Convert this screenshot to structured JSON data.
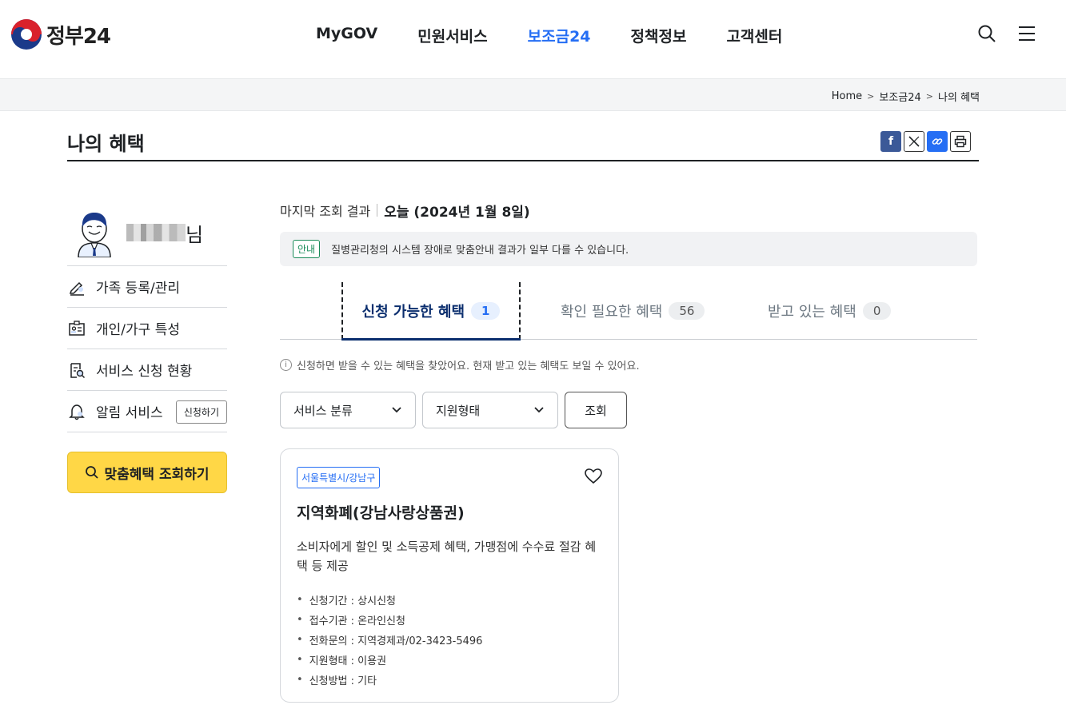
{
  "header": {
    "logo_text": "정부24",
    "nav": [
      {
        "label": "MyGOV",
        "active": false
      },
      {
        "label": "민원서비스",
        "active": false
      },
      {
        "label": "보조금24",
        "active": true
      },
      {
        "label": "정책정보",
        "active": false
      },
      {
        "label": "고객센터",
        "active": false
      }
    ]
  },
  "breadcrumb": [
    "Home",
    "보조금24",
    "나의 혜택"
  ],
  "page": {
    "title": "나의 혜택"
  },
  "sidebar": {
    "user_suffix": "님",
    "items": [
      {
        "label": "가족 등록/관리",
        "icon": "pencil-icon"
      },
      {
        "label": "개인/가구 특성",
        "icon": "id-card-icon"
      },
      {
        "label": "서비스 신청 현황",
        "icon": "clipboard-search-icon"
      },
      {
        "label": "알림 서비스",
        "icon": "bell-icon",
        "button": "신청하기"
      }
    ],
    "search_button": "맞춤혜택 조회하기"
  },
  "main": {
    "last_view_label": "마지막 조회 결과",
    "last_view_date": "오늘 (2024년 1월 8일)",
    "notice_tag": "안내",
    "notice_text": "질병관리청의 시스템 장애로 맞춤안내 결과가 일부 다를 수 있습니다.",
    "tabs": [
      {
        "label": "신청 가능한 혜택",
        "count": "1",
        "active": true
      },
      {
        "label": "확인 필요한 혜택",
        "count": "56",
        "active": false
      },
      {
        "label": "받고 있는 혜택",
        "count": "0",
        "active": false
      }
    ],
    "hint": "신청하면 받을 수 있는 혜택을 찾았어요. 현재 받고 있는 혜택도 보일 수 있어요.",
    "filters": {
      "category": "서비스 분류",
      "support_type": "지원형태",
      "query_button": "조회"
    },
    "card": {
      "region": "서울특별시/강남구",
      "title": "지역화폐(강남사랑상품권)",
      "description": "소비자에게 할인 및 소득공제 혜택, 가맹점에 수수료 절감 혜택 등 제공",
      "details": [
        "신청기간 : 상시신청",
        "접수기관 : 온라인신청",
        "전화문의 : 지역경제과/02-3423-5496",
        "지원형태 : 이용권",
        "신청방법 : 기타"
      ]
    }
  },
  "colors": {
    "accent": "#256ef4",
    "navy": "#0b2e6e",
    "yellow": "#ffd746"
  }
}
